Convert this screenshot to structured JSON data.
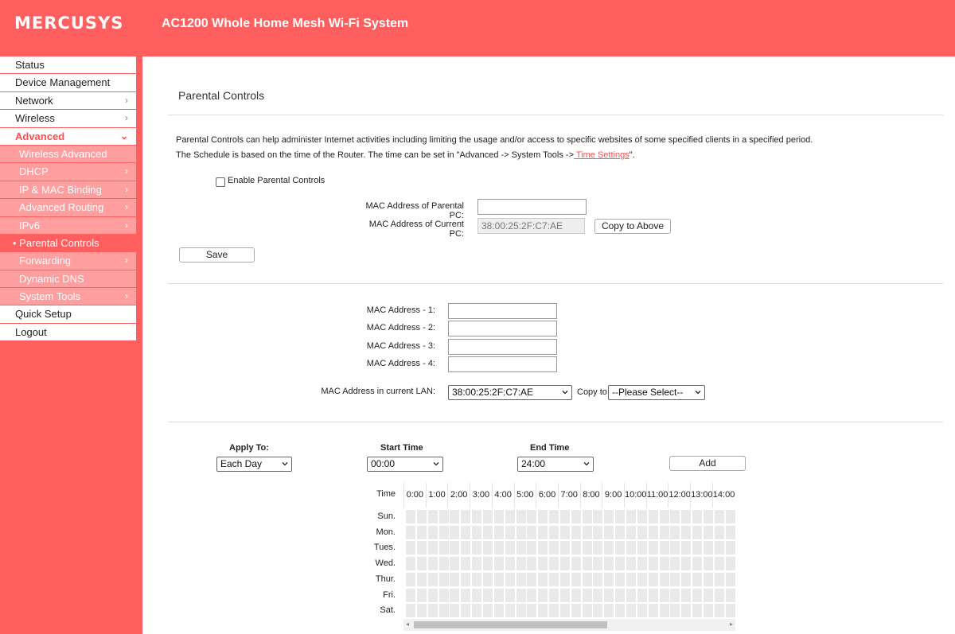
{
  "header": {
    "logo": "MERCUSYS",
    "product": "AC1200 Whole Home Mesh Wi-Fi System"
  },
  "sidebar": {
    "items": [
      {
        "label": "Status",
        "chevron": "",
        "type": "top"
      },
      {
        "label": "Device Management",
        "chevron": "",
        "type": "top"
      },
      {
        "label": "Network",
        "chevron": "›",
        "type": "top"
      },
      {
        "label": "Wireless",
        "chevron": "›",
        "type": "top"
      },
      {
        "label": "Advanced",
        "chevron": "⌄",
        "type": "active-parent"
      },
      {
        "label": "Wireless Advanced",
        "chevron": "",
        "type": "sub"
      },
      {
        "label": "DHCP",
        "chevron": "›",
        "type": "sub"
      },
      {
        "label": "IP & MAC Binding",
        "chevron": "›",
        "type": "sub"
      },
      {
        "label": "Advanced Routing",
        "chevron": "›",
        "type": "sub"
      },
      {
        "label": "IPv6",
        "chevron": "›",
        "type": "sub"
      },
      {
        "label": "• Parental Controls",
        "chevron": "",
        "type": "sub current"
      },
      {
        "label": "Forwarding",
        "chevron": "›",
        "type": "sub"
      },
      {
        "label": "Dynamic DNS",
        "chevron": "",
        "type": "sub"
      },
      {
        "label": "System Tools",
        "chevron": "›",
        "type": "sub"
      },
      {
        "label": "Quick Setup",
        "chevron": "",
        "type": "top"
      },
      {
        "label": "Logout",
        "chevron": "",
        "type": "top"
      }
    ]
  },
  "main": {
    "title": "Parental Controls",
    "desc1": "Parental Controls can help administer Internet activities including limiting the usage and/or access to specific websites of some specified clients in a specified period.",
    "desc2_prefix": "The Schedule is based on the time of the Router. The time can be set in \"Advanced -> System Tools ->",
    "desc2_link": " Time Settings",
    "desc2_suffix": "\".",
    "enable_label": "Enable Parental Controls",
    "enable_checked": false,
    "mac_parental_label": "MAC Address of Parental PC:",
    "mac_parental_value": "",
    "mac_current_label": "MAC Address of Current PC:",
    "mac_current_value": "38:00:25:2F:C7:AE",
    "copy_above_label": "Copy to Above",
    "save_label": "Save"
  },
  "mac_list": {
    "labels": [
      "MAC Address - 1:",
      "MAC Address - 2:",
      "MAC Address - 3:",
      "MAC Address - 4:"
    ],
    "values": [
      "",
      "",
      "",
      ""
    ],
    "lan_label": "MAC Address in current LAN:",
    "lan_selected": "38:00:25:2F:C7:AE",
    "copy_to_label": "Copy to",
    "copy_to_selected": "--Please Select--"
  },
  "schedule": {
    "apply_to_label": "Apply To:",
    "apply_to_selected": "Each Day",
    "start_label": "Start Time",
    "start_selected": "00:00",
    "end_label": "End Time",
    "end_selected": "24:00",
    "add_label": "Add",
    "time_header": "Time",
    "hours": [
      "0:00",
      "1:00",
      "2:00",
      "3:00",
      "4:00",
      "5:00",
      "6:00",
      "7:00",
      "8:00",
      "9:00",
      "10:00",
      "11:00",
      "12:00",
      "13:00",
      "14:00"
    ],
    "days": [
      "Sun.",
      "Mon.",
      "Tues.",
      "Wed.",
      "Thur.",
      "Fri.",
      "Sat."
    ]
  },
  "colors": {
    "brand": "#ff5f5f",
    "sub_menu": "#ff9e9e",
    "link": "#ff4d4d"
  }
}
